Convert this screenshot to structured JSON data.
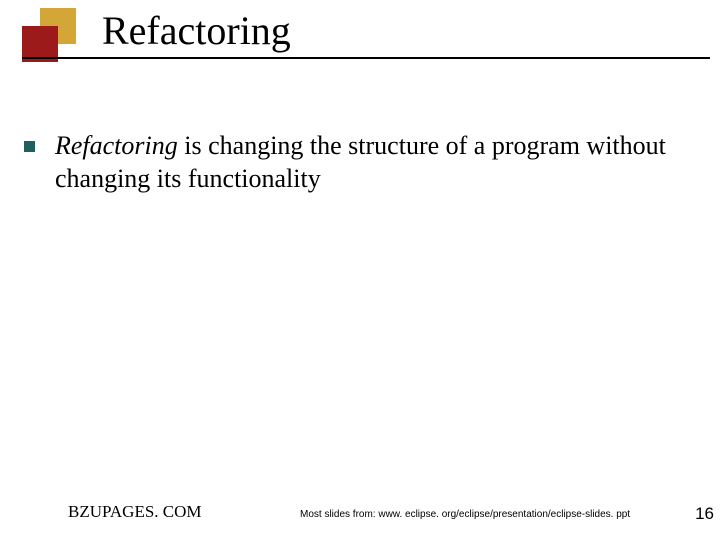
{
  "slide": {
    "title": "Refactoring",
    "bullet": {
      "italic_word": "Refactoring",
      "rest": " is changing the structure of a program without changing its functionality"
    }
  },
  "footer": {
    "left": "BZUPAGES. COM",
    "center": "Most slides from: www. eclipse. org/eclipse/presentation/eclipse-slides. ppt",
    "page_number": "16"
  },
  "colors": {
    "gold": "#d4a638",
    "red": "#9c1a1a",
    "teal": "#1f5f5f"
  }
}
